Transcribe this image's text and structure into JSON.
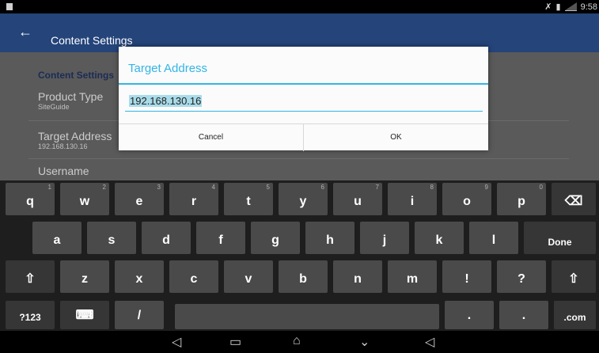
{
  "status": {
    "time": "9:58"
  },
  "app": {
    "title": "Content Settings"
  },
  "settings": {
    "header": "Content Settings",
    "product_type_label": "Product Type",
    "product_type_value": "SiteGuide",
    "target_label": "Target Address",
    "target_value": "192.168.130.16",
    "username_label": "Username"
  },
  "dialog": {
    "title": "Target Address",
    "input_value": "192.168.130.16",
    "cancel": "Cancel",
    "ok": "OK"
  },
  "keyboard": {
    "row1": [
      {
        "key": "q",
        "hint": "1"
      },
      {
        "key": "w",
        "hint": "2"
      },
      {
        "key": "e",
        "hint": "3"
      },
      {
        "key": "r",
        "hint": "4"
      },
      {
        "key": "t",
        "hint": "5"
      },
      {
        "key": "y",
        "hint": "6"
      },
      {
        "key": "u",
        "hint": "7"
      },
      {
        "key": "i",
        "hint": "8"
      },
      {
        "key": "o",
        "hint": "9"
      },
      {
        "key": "p",
        "hint": "0"
      }
    ],
    "row2": [
      "a",
      "s",
      "d",
      "f",
      "g",
      "h",
      "j",
      "k",
      "l"
    ],
    "row3": [
      "z",
      "x",
      "c",
      "v",
      "b",
      "n",
      "m",
      "!",
      "?"
    ],
    "done": "Done",
    "sym": "?123",
    "com": ".com",
    "period": ".",
    "period2": "."
  },
  "icons": {
    "back": "back-arrow-icon",
    "backspace": "backspace-icon",
    "shift": "shift-icon",
    "nav_back": "nav-back-icon",
    "nav_home": "nav-home-icon",
    "nav_recents": "nav-recents-icon"
  }
}
